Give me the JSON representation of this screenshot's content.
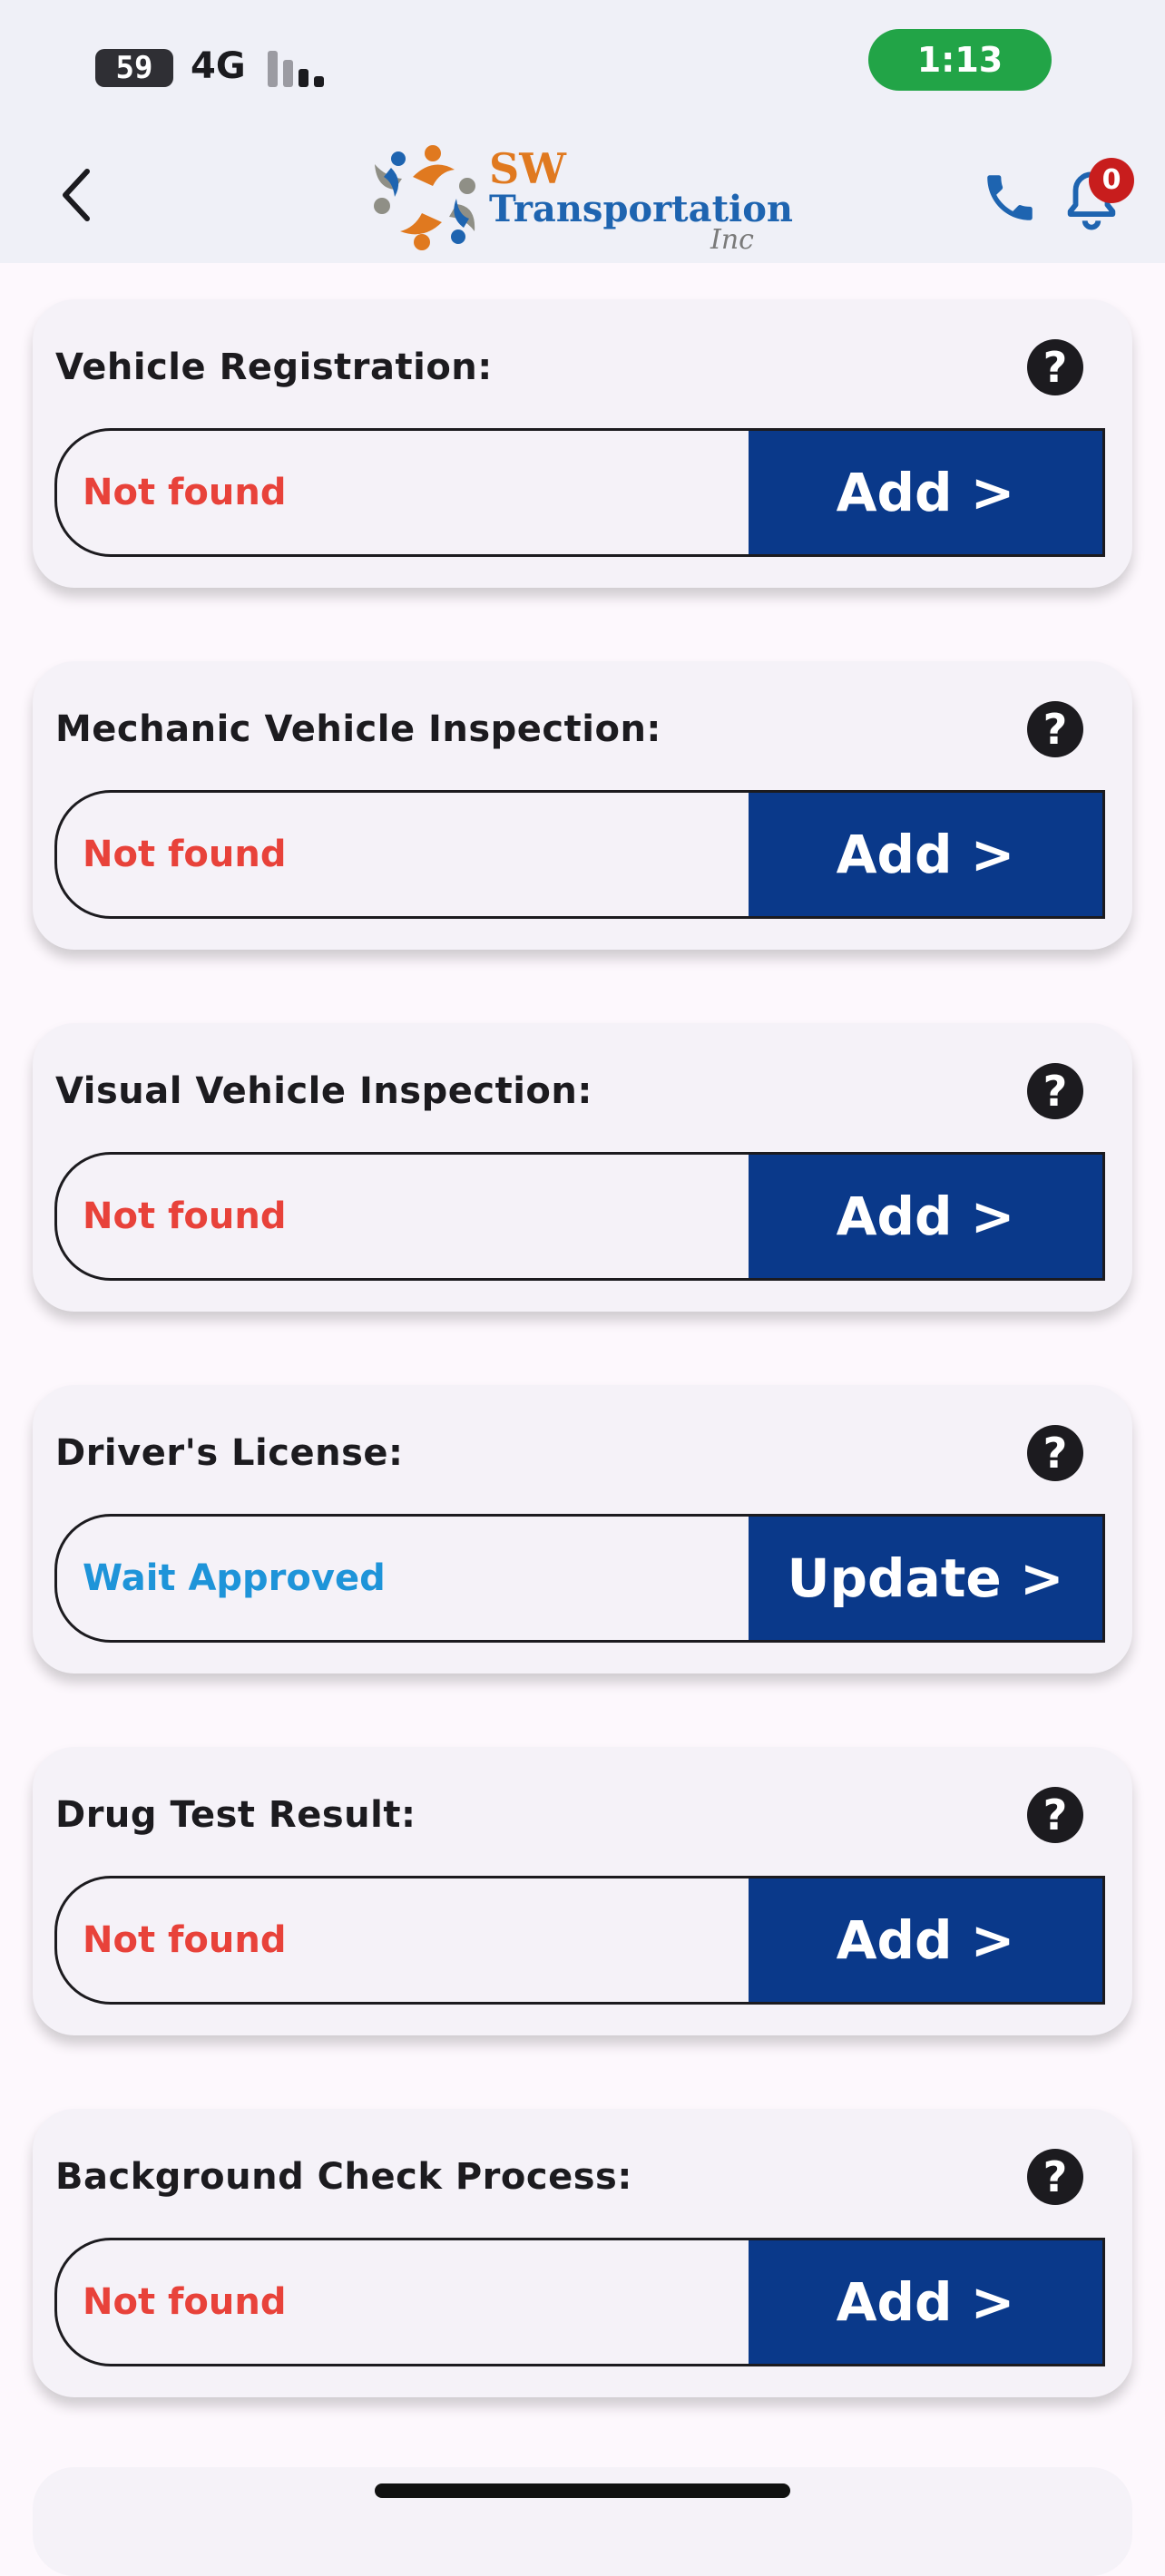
{
  "status_bar": {
    "battery": "59",
    "network": "4G",
    "time": "1:13",
    "time_pill_color": "#22a447"
  },
  "header": {
    "back_icon": "chevron-left-icon",
    "logo": {
      "line1": "SW",
      "line2": "Transportation",
      "line3": "Inc"
    },
    "phone_icon": "phone-icon",
    "notification_icon": "bell-icon",
    "notification_count": "0"
  },
  "colors": {
    "status_not_found": "#e8423a",
    "status_wait_approved": "#1e94d9",
    "action_background": "#0a398a"
  },
  "documents": [
    {
      "title": "Vehicle Registration:",
      "status": "Not found",
      "status_type": "not_found",
      "action": "Add >"
    },
    {
      "title": "Mechanic Vehicle Inspection:",
      "status": "Not found",
      "status_type": "not_found",
      "action": "Add >"
    },
    {
      "title": "Visual Vehicle Inspection:",
      "status": "Not found",
      "status_type": "not_found",
      "action": "Add >"
    },
    {
      "title": "Driver's License:",
      "status": "Wait Approved",
      "status_type": "wait_approved",
      "action": "Update >"
    },
    {
      "title": "Drug Test Result:",
      "status": "Not found",
      "status_type": "not_found",
      "action": "Add >"
    },
    {
      "title": "Background Check Process:",
      "status": "Not found",
      "status_type": "not_found",
      "action": "Add >"
    }
  ]
}
